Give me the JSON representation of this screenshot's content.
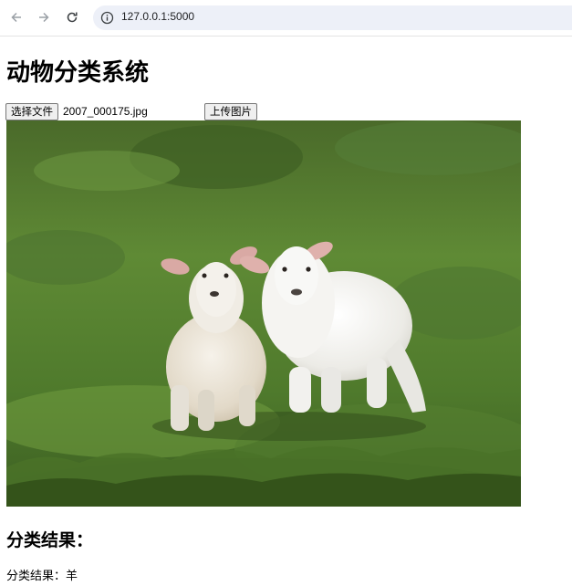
{
  "browser": {
    "url": "127.0.0.1:5000",
    "icons": {
      "back": "arrow-left-icon",
      "forward": "arrow-right-icon",
      "reload": "reload-icon",
      "site_info": "info-icon"
    }
  },
  "page": {
    "title": "动物分类系统",
    "choose_file_label": "选择文件",
    "selected_file": "2007_000175.jpg",
    "upload_label": "上传图片",
    "result_heading": "分类结果：",
    "result_text": "分类结果：羊"
  }
}
